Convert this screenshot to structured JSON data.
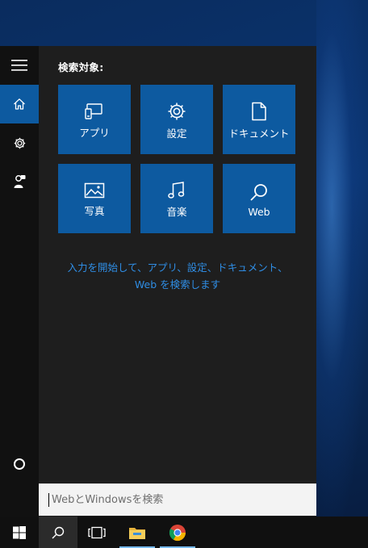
{
  "panel": {
    "heading": "検索対象:",
    "tiles": [
      {
        "label": "アプリ",
        "icon": "apps-icon"
      },
      {
        "label": "設定",
        "icon": "gear-icon"
      },
      {
        "label": "ドキュメント",
        "icon": "document-icon"
      },
      {
        "label": "写真",
        "icon": "photo-icon"
      },
      {
        "label": "音楽",
        "icon": "music-icon"
      },
      {
        "label": "Web",
        "icon": "search-icon"
      }
    ],
    "hint_line1": "入力を開始して、アプリ、設定、ドキュメント、",
    "hint_line2": "Web を検索します"
  },
  "rail": {
    "items": [
      {
        "icon": "hamburger-menu-icon"
      },
      {
        "icon": "home-icon",
        "active": true
      },
      {
        "icon": "gear-icon"
      },
      {
        "icon": "feedback-icon"
      },
      {
        "icon": "cortana-circle-icon"
      }
    ]
  },
  "search": {
    "placeholder": "WebとWindowsを検索"
  },
  "taskbar": {
    "items": [
      {
        "icon": "windows-logo-icon"
      },
      {
        "icon": "search-icon",
        "active": true
      },
      {
        "icon": "task-view-icon"
      },
      {
        "icon": "file-explorer-icon",
        "running": true
      },
      {
        "icon": "chrome-icon",
        "running": true
      }
    ]
  },
  "colors": {
    "accent": "#0d5aa0",
    "hint_text": "#2f8de4",
    "panel_bg": "#1e1e1e",
    "rail_bg": "#111111",
    "taskbar_bg": "#101010"
  }
}
